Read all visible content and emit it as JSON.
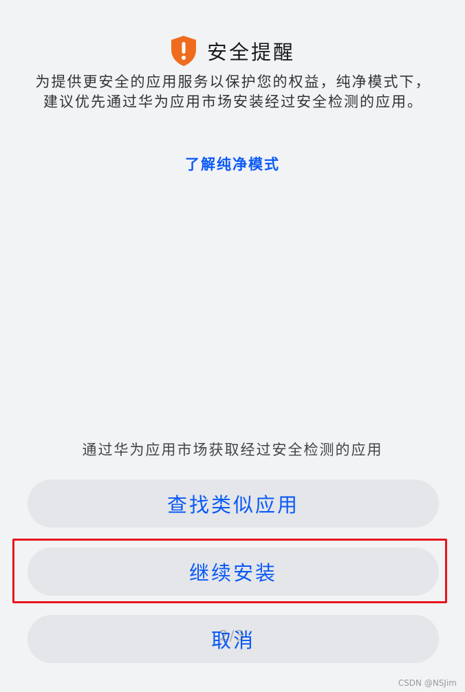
{
  "dialog": {
    "title": "安全提醒",
    "description": "为提供更安全的应用服务以保护您的权益，纯净模式下，建议优先通过华为应用市场安装经过安全检测的应用。",
    "learn_link": "了解纯净模式",
    "icon": "warning-shield-icon",
    "icon_color": "#ef6c1f"
  },
  "actions": {
    "hint": "通过华为应用市场获取经过安全检测的应用",
    "find_similar_label": "查找类似应用",
    "continue_install_label": "继续安装",
    "cancel_label": "取消"
  },
  "overlay": {
    "page_indicator": "2/3",
    "highlight_color": "#e8141b"
  },
  "watermark": "CSDN @NSJim",
  "theme": {
    "background": "#f1f3f5",
    "button_bg": "#e4e6e9",
    "accent": "#0a59f7"
  }
}
